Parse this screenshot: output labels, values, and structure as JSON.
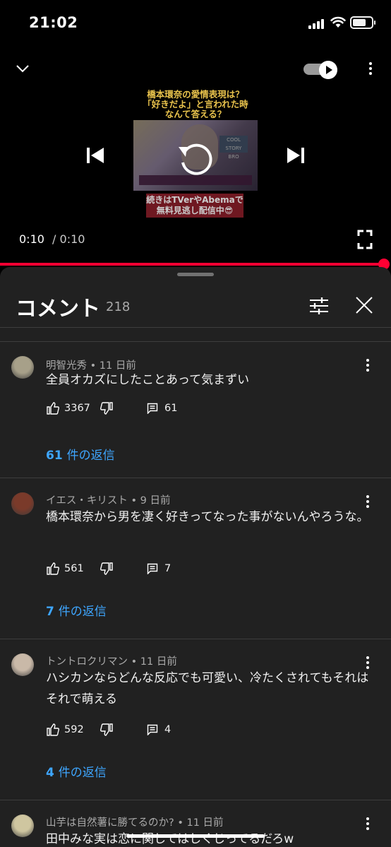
{
  "status_bar": {
    "time": "21:02"
  },
  "player": {
    "thumbnail": {
      "title_lines": [
        "橋本環奈の愛情表現は？",
        "「好きだよ」と言われた時",
        "なんて答える？"
      ],
      "box_label": "COOL STORY BRO",
      "footer_lines": [
        "続きはTVerやAbemaで",
        "無料見逃し配信中😎"
      ]
    },
    "current_time": "0:10",
    "separator": "/",
    "duration": "0:10",
    "progress_fraction": 1.0,
    "autoplay": true
  },
  "comments_panel": {
    "title": "コメント",
    "count": "218",
    "comments": [
      {
        "author": "明智光秀",
        "age": "11 日前",
        "text": "全員オカズにしたことあって気まずい",
        "likes": "3367",
        "replies": "61",
        "reply_link_count": "61",
        "reply_link_label": "件の返信",
        "avatar_color": "#a7a089"
      },
      {
        "author": "イエス・キリスト",
        "age": "9 日前",
        "text": "橋本環奈から男を凄く好きってなった事がないんやろうな。",
        "likes": "561",
        "replies": "7",
        "reply_link_count": "7",
        "reply_link_label": "件の返信",
        "avatar_color": "#7a3a2a"
      },
      {
        "author": "トントロクリマン",
        "age": "11 日前",
        "text": "ハシカンならどんな反応でも可愛い、冷たくされてもそれはそれで萌える",
        "likes": "592",
        "replies": "4",
        "reply_link_count": "4",
        "reply_link_label": "件の返信",
        "avatar_color": "#c9b9a8"
      },
      {
        "author": "山芋は自然薯に勝てるのか?",
        "age": "11 日前",
        "text": "田中みな実は恋に関してはしくじってるだろw",
        "avatar_color": "#cfc6a0"
      }
    ]
  },
  "meta_separator": "•"
}
